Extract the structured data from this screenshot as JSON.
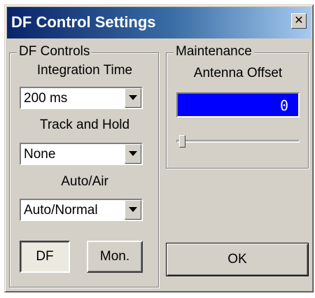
{
  "window": {
    "title": "DF Control Settings",
    "close_label": "✕"
  },
  "df_controls": {
    "group_label": "DF Controls",
    "integration_time": {
      "label": "Integration Time",
      "value": "200 ms"
    },
    "track_and_hold": {
      "label": "Track and Hold",
      "value": "None"
    },
    "auto_air": {
      "label": "Auto/Air",
      "value": "Auto/Normal"
    },
    "df_button": "DF",
    "mon_button": "Mon."
  },
  "maintenance": {
    "group_label": "Maintenance",
    "antenna_offset": {
      "label": "Antenna Offset",
      "value": "0",
      "slider_fraction": 0.0
    }
  },
  "ok_button": "OK",
  "colors": {
    "display_bg": "#0000ff",
    "title_start": "#0a246a",
    "title_end": "#a6caf0"
  }
}
